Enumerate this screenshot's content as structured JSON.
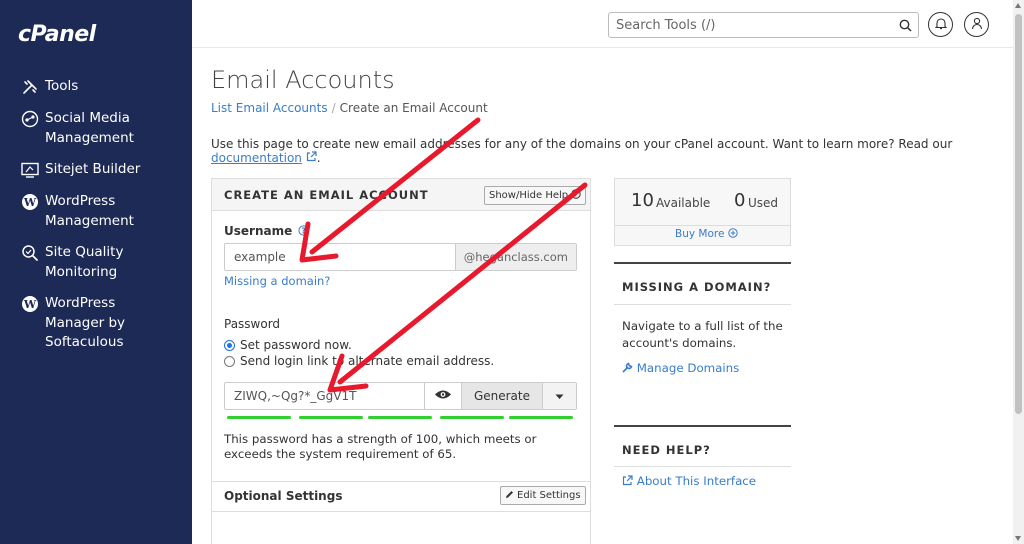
{
  "sidebar": {
    "logo": "cPanel",
    "items": [
      {
        "label": "Tools",
        "icon": "tools-icon"
      },
      {
        "label": "Social Media Management",
        "icon": "social-icon"
      },
      {
        "label": "Sitejet Builder",
        "icon": "sitejet-icon"
      },
      {
        "label": "WordPress Management",
        "icon": "wordpress-icon"
      },
      {
        "label": "Site Quality Monitoring",
        "icon": "quality-icon"
      },
      {
        "label": "WordPress Manager by Softaculous",
        "icon": "wordpress-icon"
      }
    ]
  },
  "header": {
    "search_placeholder": "Search Tools (/)"
  },
  "page": {
    "title": "Email Accounts",
    "breadcrumb": {
      "parent": "List Email Accounts",
      "sep": "/",
      "current": "Create an Email Account"
    },
    "intro_text": "Use this page to create new email addresses for any of the domains on your cPanel account. Want to learn more? Read our ",
    "intro_link": "documentation",
    "intro_end": "."
  },
  "form": {
    "title": "CREATE AN EMAIL ACCOUNT",
    "show_hide_help": "Show/Hide Help",
    "username_label": "Username",
    "username_value": "example",
    "domain_addon": "@heganclass.com",
    "missing_domain_link": "Missing a domain?",
    "password_label": "Password",
    "radio_set_now": "Set password now.",
    "radio_send_link": "Send login link to alternate email address.",
    "password_value": "ZIWQ,~Qg?*_GgV1T",
    "generate_label": "Generate",
    "strength_note": "This password has a strength of 100, which meets or exceeds the system requirement of 65.",
    "optional_settings": "Optional Settings",
    "edit_settings": "Edit Settings"
  },
  "stats": {
    "available_num": "10",
    "available_label": "Available",
    "used_num": "0",
    "used_label": "Used",
    "buy_more": "Buy More"
  },
  "right": {
    "missing_title": "MISSING A DOMAIN?",
    "missing_text": "Navigate to a full list of the account's domains.",
    "manage_domains": "Manage Domains",
    "help_title": "NEED HELP?",
    "about_link": "About This Interface"
  },
  "colors": {
    "sidebar": "#1c2a55",
    "link": "#3a7ccb",
    "arrow": "#e8192c",
    "strength": "#2fd02f"
  }
}
